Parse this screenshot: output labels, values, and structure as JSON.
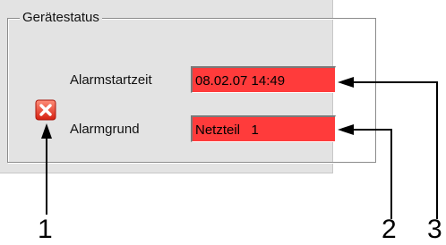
{
  "group": {
    "title": "Gerätestatus"
  },
  "alarm": {
    "start_label": "Alarmstartzeit",
    "start_value": "08.02.07 14:49",
    "reason_label": "Alarmgrund",
    "reason_value": "Netzteil   1",
    "icon": "error-x-icon",
    "field_color": "#ff3b3b"
  },
  "callouts": {
    "one": "1",
    "two": "2",
    "three": "3"
  }
}
